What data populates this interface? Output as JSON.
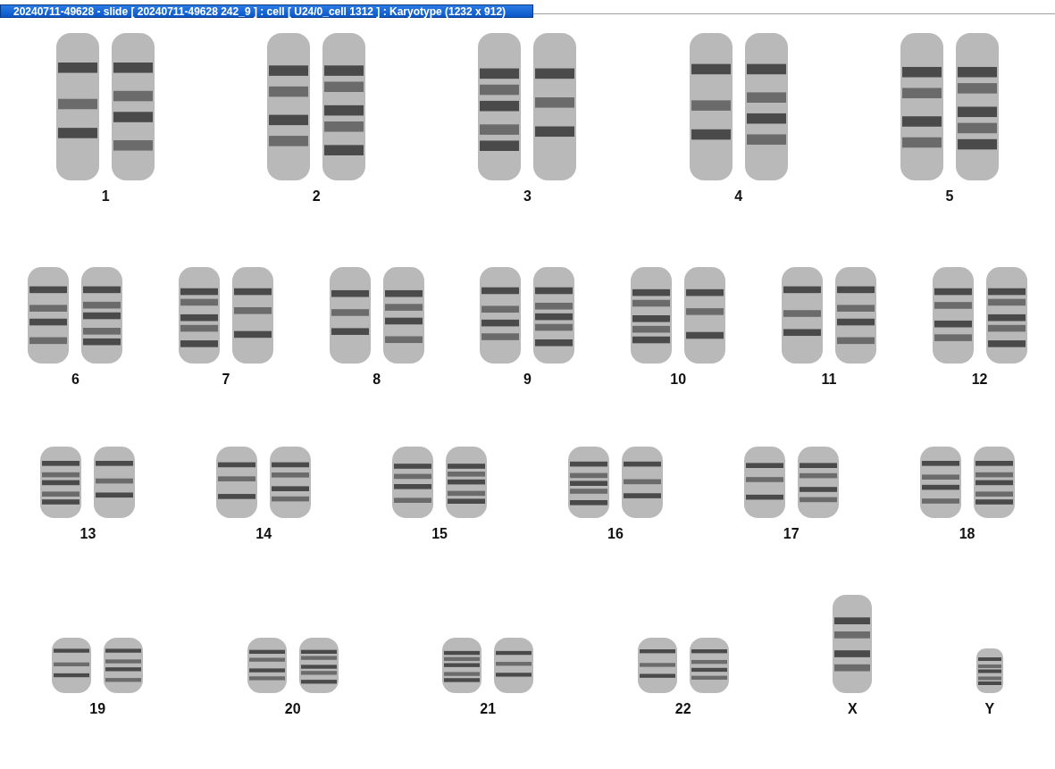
{
  "window": {
    "title": "20240711-49628 - slide [ 20240711-49628 242_9 ] : cell [ U24/0_cell 1312 ] : Karyotype  (1232 x 912)"
  },
  "rows": [
    {
      "chromosomes": [
        {
          "label": "1"
        },
        {
          "label": "2"
        },
        {
          "label": "3"
        },
        {
          "label": "4"
        },
        {
          "label": "5"
        }
      ]
    },
    {
      "chromosomes": [
        {
          "label": "6"
        },
        {
          "label": "7"
        },
        {
          "label": "8"
        },
        {
          "label": "9"
        },
        {
          "label": "10"
        },
        {
          "label": "11"
        },
        {
          "label": "12"
        }
      ]
    },
    {
      "chromosomes": [
        {
          "label": "13"
        },
        {
          "label": "14"
        },
        {
          "label": "15"
        },
        {
          "label": "16"
        },
        {
          "label": "17"
        },
        {
          "label": "18"
        }
      ]
    },
    {
      "chromosomes": [
        {
          "label": "19"
        },
        {
          "label": "20"
        },
        {
          "label": "21"
        },
        {
          "label": "22"
        },
        {
          "label": "X"
        },
        {
          "label": "Y"
        }
      ]
    }
  ]
}
